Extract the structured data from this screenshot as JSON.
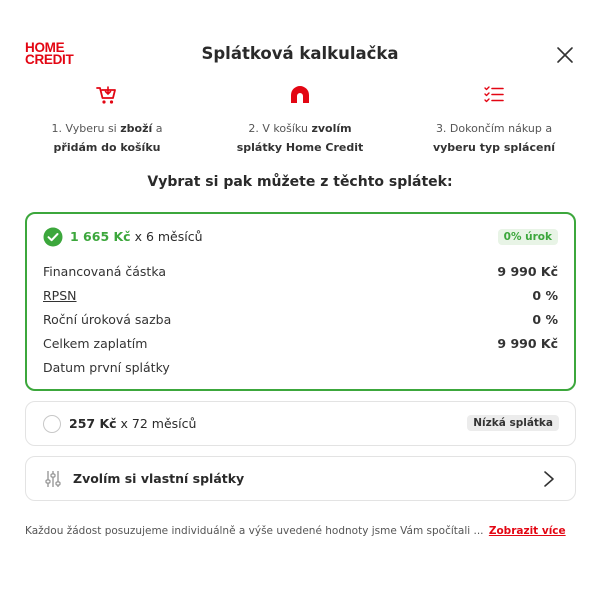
{
  "header": {
    "logo_line1": "HOME",
    "logo_line2": "CREDIT",
    "title": "Splátková kalkulačka"
  },
  "steps": [
    {
      "pre": "1. Vyberu si ",
      "bold": "zboží",
      "post": " a",
      "line2_pre": "přidám do košíku",
      "line2_bold": "",
      "icon": "cart-icon"
    },
    {
      "pre": "2. V košíku ",
      "bold": "zvolím",
      "post": "",
      "line2_pre": "",
      "line2_bold": "splátky Home Credit",
      "icon": "home-credit-mark-icon"
    },
    {
      "pre": "3. Dokončím nákup a",
      "bold": "",
      "post": "",
      "line2_pre": "",
      "line2_bold": "vyberu typ splácení",
      "icon": "checklist-icon"
    }
  ],
  "subtitle": "Vybrat si pak můžete z těchto splátek:",
  "options": {
    "selected": {
      "amount": "1 665 Kč",
      "term": " x 6 měsíců",
      "badge": "0% úrok",
      "details": [
        {
          "label": "Financovaná částka",
          "value": "9 990 Kč"
        },
        {
          "label": "RPSN",
          "value": "0 %"
        },
        {
          "label": "Roční úroková sazba",
          "value": "0 %"
        },
        {
          "label": "Celkem zaplatím",
          "value": "9 990 Kč"
        },
        {
          "label": "Datum první splátky",
          "value": ""
        }
      ]
    },
    "second": {
      "amount": "257 Kč",
      "term": " x 72 měsíců",
      "badge": "Nízká splátka"
    },
    "custom": {
      "label": "Zvolím si vlastní splátky"
    }
  },
  "footer": {
    "text": "Každou žádost posuzujeme individuálně a výše uvedené hodnoty jsme Vám spočítali ...",
    "link": "Zobrazit více"
  },
  "colors": {
    "brand_red": "#e30613",
    "accent_green": "#3ca73c"
  }
}
